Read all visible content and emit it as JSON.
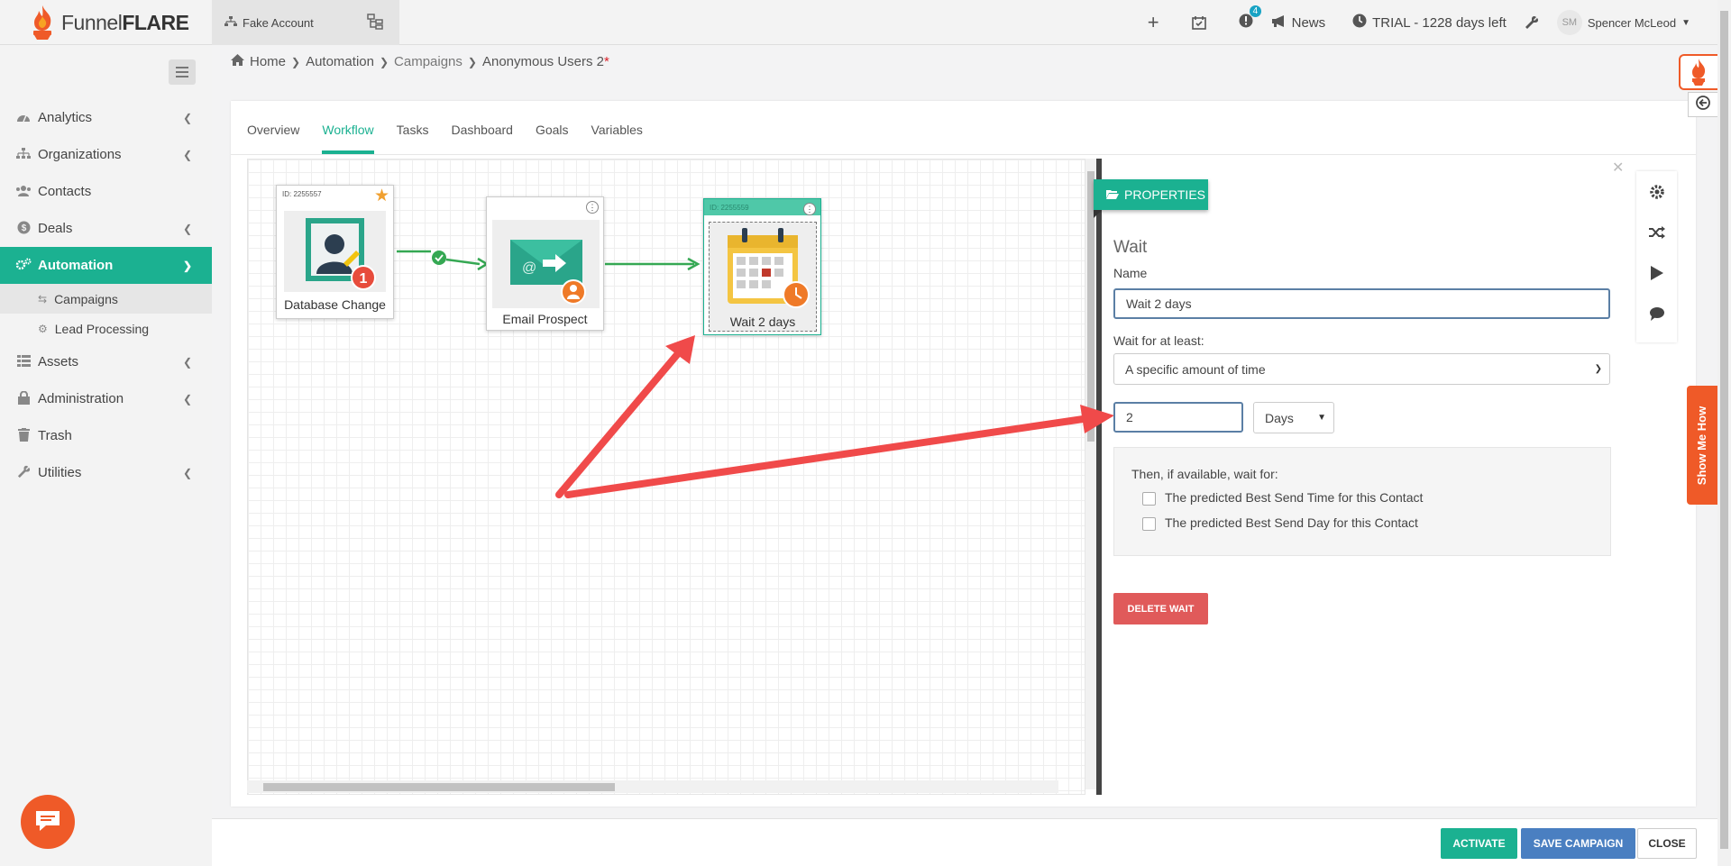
{
  "topbar": {
    "logo_light": "Funnel",
    "logo_bold": "FLARE",
    "account_label": "Fake Account",
    "notifications_count": "4",
    "news_label": "News",
    "trial_label": "TRIAL - 1228 days left",
    "user_initials": "SM",
    "user_name": "Spencer McLeod"
  },
  "sidebar": {
    "items": [
      {
        "label": "Analytics",
        "icon": "dashboard-icon"
      },
      {
        "label": "Organizations",
        "icon": "sitemap-icon"
      },
      {
        "label": "Contacts",
        "icon": "users-icon"
      },
      {
        "label": "Deals",
        "icon": "dollar-icon"
      },
      {
        "label": "Automation",
        "icon": "cogs-icon"
      },
      {
        "label": "Assets",
        "icon": "grid-icon"
      },
      {
        "label": "Administration",
        "icon": "lock-icon"
      },
      {
        "label": "Trash",
        "icon": "trash-icon"
      },
      {
        "label": "Utilities",
        "icon": "wrench-icon"
      }
    ],
    "sub_items": [
      {
        "label": "Campaigns",
        "icon": "retweet-icon"
      },
      {
        "label": "Lead Processing",
        "icon": "cogs-icon"
      }
    ]
  },
  "breadcrumb": {
    "home": "Home",
    "automation": "Automation",
    "campaigns": "Campaigns",
    "current": "Anonymous Users 2",
    "required": "*"
  },
  "tabs": [
    "Overview",
    "Workflow",
    "Tasks",
    "Dashboard",
    "Goals",
    "Variables"
  ],
  "active_tab": "Workflow",
  "workflow": {
    "nodes": [
      {
        "id_label": "ID: 2255557",
        "label": "Database Change",
        "badge": "1"
      },
      {
        "id_label": "",
        "label": "Email Prospect"
      },
      {
        "id_label": "ID: 2255559",
        "label": "Wait 2 days"
      }
    ]
  },
  "properties": {
    "button_label": "PROPERTIES",
    "title": "Wait",
    "name_label": "Name",
    "name_value": "Wait 2 days",
    "wait_for_label": "Wait for at least:",
    "wait_for_value": "A specific amount of time",
    "amount_value": "2",
    "unit_value": "Days",
    "then_label": "Then, if available, wait for:",
    "option1": "The predicted Best Send Time for this Contact",
    "option2": "The predicted Best Send Day for this Contact",
    "delete_label": "DELETE WAIT"
  },
  "footer": {
    "activate": "ACTIVATE",
    "save": "SAVE CAMPAIGN",
    "close": "CLOSE"
  },
  "show_me_how": "Show Me How",
  "colors": {
    "accent": "#1bb191",
    "danger": "#e05a5a",
    "save": "#4a7fc1",
    "brand_orange": "#ef5a28",
    "annotation_arrow": "#f04a4a"
  }
}
